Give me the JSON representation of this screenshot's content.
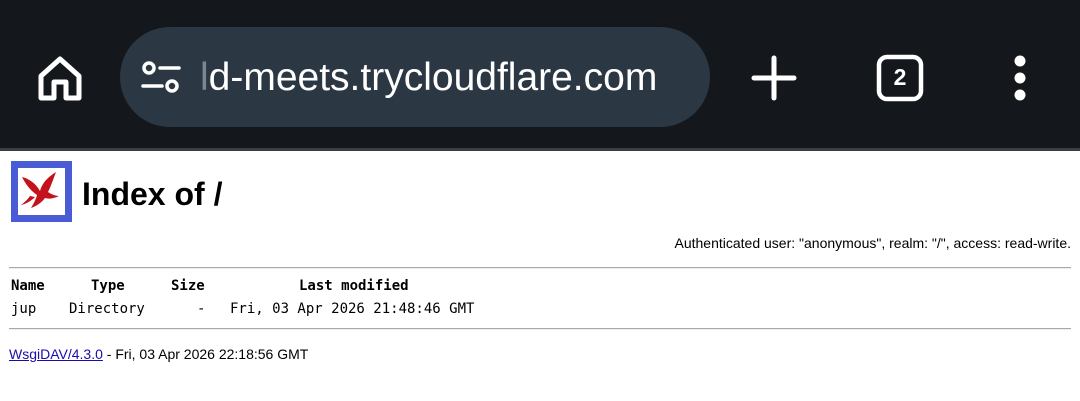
{
  "browser": {
    "url_faded_part": "l",
    "url_main": "d-meets.trycloudflare.com",
    "tab_count": "2",
    "icons": {
      "home": "home-icon",
      "site_settings": "tune-icon",
      "new_tab": "plus-icon",
      "tabs": "tab-switcher-icon",
      "menu": "more-vert-icon"
    },
    "colors": {
      "toolbar": "#14181c",
      "url_bar": "#2b3844"
    }
  },
  "page": {
    "title": "Index of /",
    "auth_info": "Authenticated user: \"anonymous\", realm: \"/\", access: read-write.",
    "table": {
      "headers": {
        "name": "Name",
        "type": "Type",
        "size": "Size",
        "modified": "Last modified"
      },
      "rows": [
        {
          "name": "jup",
          "type": "Directory",
          "size": "-",
          "modified": "Fri, 03 Apr 2026 21:48:46 GMT"
        }
      ]
    },
    "footer": {
      "link": "WsgiDAV/4.3.0",
      "timestamp": " - Fri, 03 Apr 2026 22:18:56 GMT"
    }
  }
}
